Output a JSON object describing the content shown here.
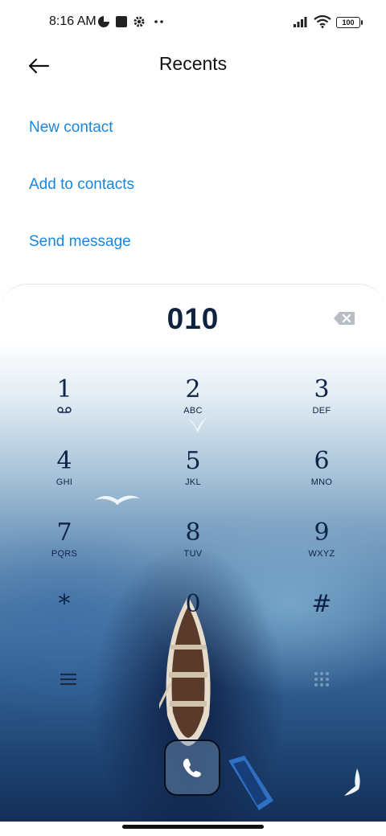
{
  "status_bar": {
    "time": "8:16 AM",
    "battery": "100"
  },
  "header": {
    "title": "Recents"
  },
  "actions": [
    {
      "label": "New contact"
    },
    {
      "label": "Add to contacts"
    },
    {
      "label": "Send message"
    }
  ],
  "dialer": {
    "number": "010",
    "keys": [
      {
        "digit": "1",
        "letters": ""
      },
      {
        "digit": "2",
        "letters": "ABC"
      },
      {
        "digit": "3",
        "letters": "DEF"
      },
      {
        "digit": "4",
        "letters": "GHI"
      },
      {
        "digit": "5",
        "letters": "JKL"
      },
      {
        "digit": "6",
        "letters": "MNO"
      },
      {
        "digit": "7",
        "letters": "PQRS"
      },
      {
        "digit": "8",
        "letters": "TUV"
      },
      {
        "digit": "9",
        "letters": "WXYZ"
      },
      {
        "digit": "*",
        "letters": ""
      },
      {
        "digit": "0",
        "letters": ""
      },
      {
        "digit": "#",
        "letters": ""
      }
    ]
  },
  "colors": {
    "link": "#1a86e0",
    "digit": "#0e2348",
    "number": "#0f2240"
  },
  "icons": {
    "back": "arrow-left-icon",
    "backspace": "backspace-icon",
    "voicemail": "voicemail-icon",
    "menu": "menu-icon",
    "keypad": "keypad-icon",
    "call": "phone-icon",
    "signal": "signal-icon",
    "wifi": "wifi-icon",
    "battery": "battery-icon",
    "settings": "gear-icon"
  }
}
